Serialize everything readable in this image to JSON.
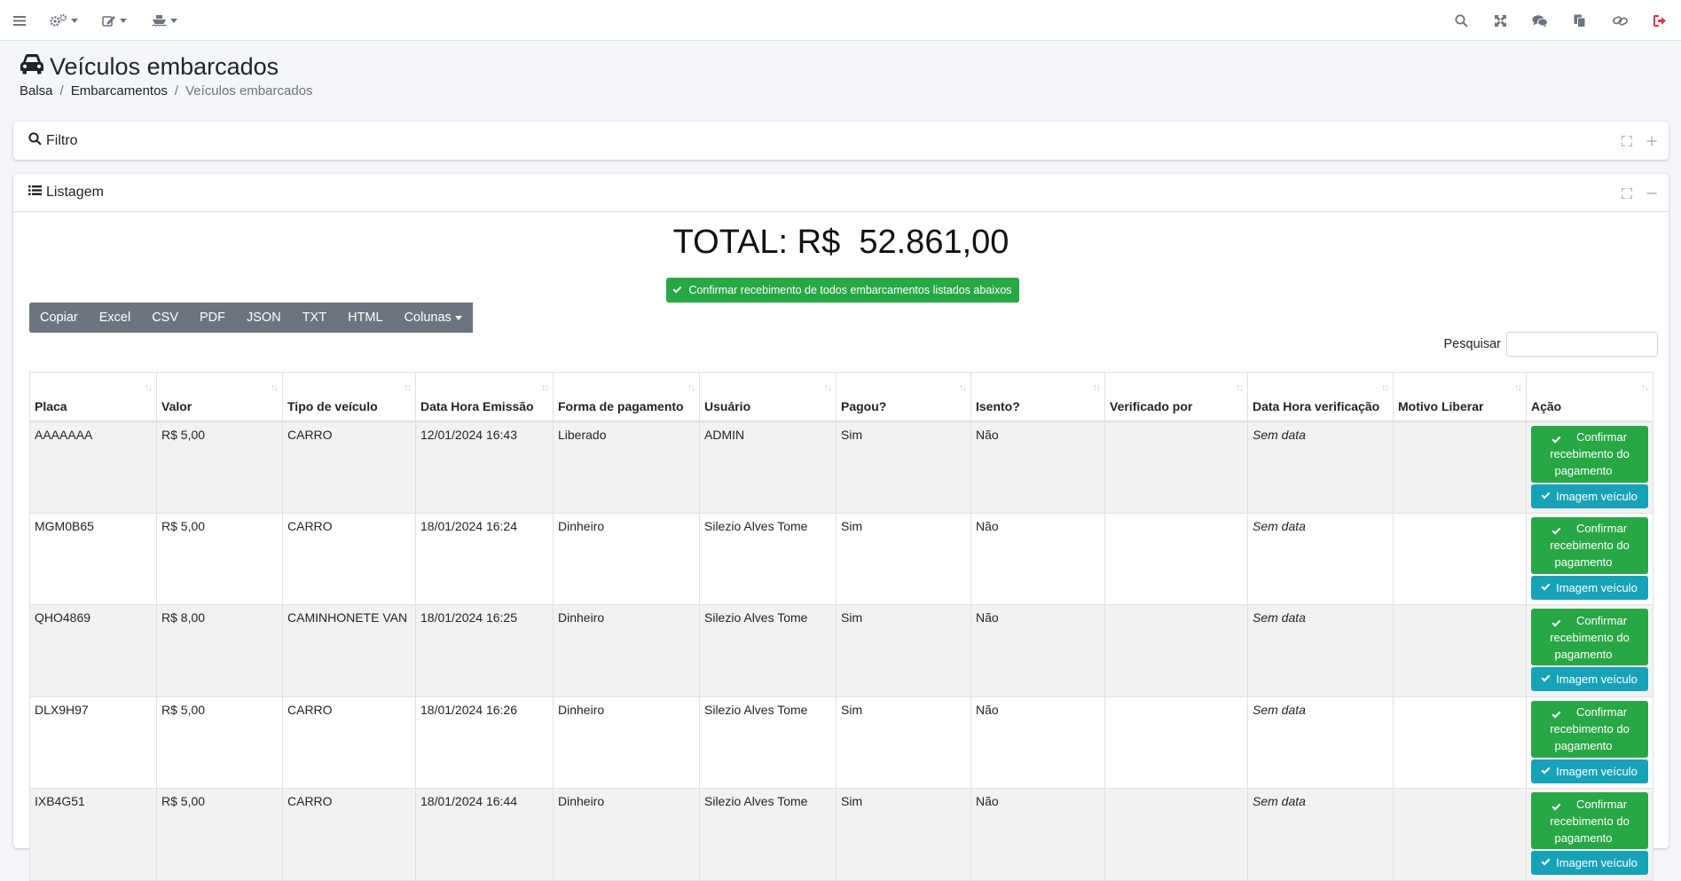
{
  "navbar": {
    "left_icons": [
      "menu-icon",
      "cogs-icon",
      "edit-icon",
      "ship-icon"
    ],
    "right_icons": [
      "search-icon",
      "expand-icon",
      "comments-icon",
      "copy-icon",
      "link-icon",
      "sign-out-icon"
    ],
    "logout_color": "#dc3545"
  },
  "page": {
    "title": "Veículos embarcados",
    "breadcrumb": [
      "Balsa",
      "Embarcamentos",
      "Veículos embarcados"
    ]
  },
  "filter_card": {
    "title": "Filtro"
  },
  "list_card": {
    "title": "Listagem",
    "total_label": "TOTAL: R$  52.861,00",
    "confirm_all_label": "Confirmar recebimento de todos embarcamentos listados abaixos",
    "export_buttons": [
      "Copiar",
      "Excel",
      "CSV",
      "PDF",
      "JSON",
      "TXT",
      "HTML",
      "Colunas"
    ],
    "search_label": "Pesquisar",
    "search_value": ""
  },
  "table": {
    "columns": [
      "Placa",
      "Valor",
      "Tipo de veículo",
      "Data Hora Emissão",
      "Forma de pagamento",
      "Usuário",
      "Pagou?",
      "Isento?",
      "Verificado por",
      "Data Hora verificação",
      "Motivo Liberar",
      "Ação"
    ],
    "rows": [
      {
        "placa": "AAAAAAA",
        "valor": "R$ 5,00",
        "tipo": "CARRO",
        "emissao": "12/01/2024 16:43",
        "forma": "Liberado",
        "usuario": "ADMIN",
        "pagou": "Sim",
        "isento": "Não",
        "verificado": "",
        "data_verif": "Sem data",
        "motivo": ""
      },
      {
        "placa": "MGM0B65",
        "valor": "R$ 5,00",
        "tipo": "CARRO",
        "emissao": "18/01/2024 16:24",
        "forma": "Dinheiro",
        "usuario": "Silezio Alves Tome",
        "pagou": "Sim",
        "isento": "Não",
        "verificado": "",
        "data_verif": "Sem data",
        "motivo": ""
      },
      {
        "placa": "QHO4869",
        "valor": "R$ 8,00",
        "tipo": "CAMINHONETE VAN",
        "emissao": "18/01/2024 16:25",
        "forma": "Dinheiro",
        "usuario": "Silezio Alves Tome",
        "pagou": "Sim",
        "isento": "Não",
        "verificado": "",
        "data_verif": "Sem data",
        "motivo": ""
      },
      {
        "placa": "DLX9H97",
        "valor": "R$ 5,00",
        "tipo": "CARRO",
        "emissao": "18/01/2024 16:26",
        "forma": "Dinheiro",
        "usuario": "Silezio Alves Tome",
        "pagou": "Sim",
        "isento": "Não",
        "verificado": "",
        "data_verif": "Sem data",
        "motivo": ""
      },
      {
        "placa": "IXB4G51",
        "valor": "R$ 5,00",
        "tipo": "CARRO",
        "emissao": "18/01/2024 16:44",
        "forma": "Dinheiro",
        "usuario": "Silezio Alves Tome",
        "pagou": "Sim",
        "isento": "Não",
        "verificado": "",
        "data_verif": "Sem data",
        "motivo": ""
      }
    ],
    "action_pay_label": "Confirmar recebimento do pagamento",
    "action_image_label": "Imagem veículo"
  },
  "colors": {
    "success": "#28a745",
    "info": "#17a2b8",
    "secondary": "#6c757d"
  }
}
